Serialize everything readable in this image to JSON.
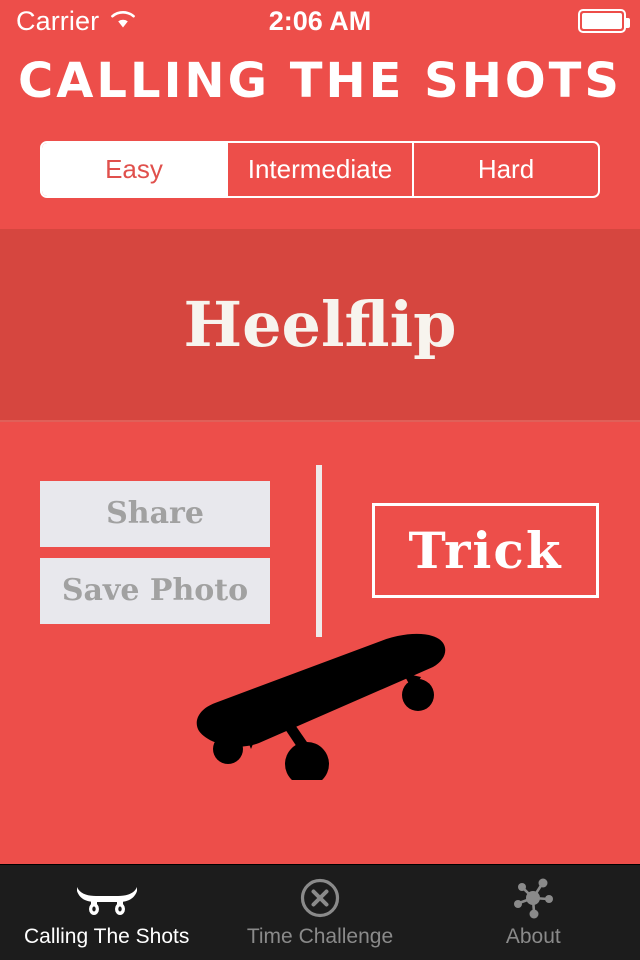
{
  "colors": {
    "background_red": "#ed4e4a",
    "panel_red": "#d6463f",
    "button_gray": "#e8e8ed",
    "button_text_gray": "#a1a1a1",
    "tabbar_dark": "#1c1c1c",
    "white": "#ffffff",
    "inactive_tab_gray": "#8a8a8a"
  },
  "status_bar": {
    "carrier": "Carrier",
    "wifi_icon": "wifi-icon",
    "time": "2:06 AM",
    "battery_icon": "battery-icon"
  },
  "header": {
    "app_title": "CALLING THE SHOTS"
  },
  "difficulty": {
    "selected": "Easy",
    "options": [
      {
        "label": "Easy",
        "selected": true
      },
      {
        "label": "Intermediate",
        "selected": false
      },
      {
        "label": "Hard",
        "selected": false
      }
    ]
  },
  "trick_display": {
    "trick_name": "Heelflip"
  },
  "actions": {
    "share_label": "Share",
    "save_photo_label": "Save Photo",
    "trick_label": "Trick",
    "skateboard_illustration": "skateboard-silhouette"
  },
  "tab_bar": {
    "items": [
      {
        "label": "Calling The Shots",
        "icon": "skateboard-icon",
        "active": true
      },
      {
        "label": "Time Challenge",
        "icon": "circle-x-icon",
        "active": false
      },
      {
        "label": "About",
        "icon": "network-nodes-icon",
        "active": false
      }
    ]
  }
}
